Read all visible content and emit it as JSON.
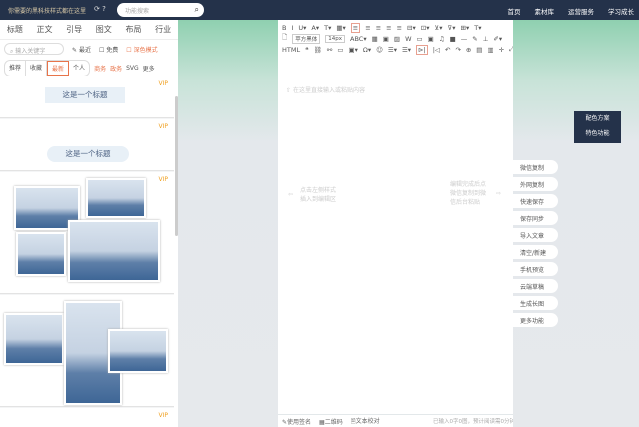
{
  "topbar": {
    "notice": "你需要的黑科技样式都在这里",
    "search_placeholder": "功能搜索",
    "nav": [
      "首页",
      "素材库",
      "运营服务",
      "学习成长"
    ]
  },
  "left": {
    "tabs": [
      "标题",
      "正文",
      "引导",
      "图文",
      "布局",
      "行业"
    ],
    "keyword_placeholder": "输入关键字",
    "recent": "最近",
    "free": "免费",
    "dark_mode": "深色模式",
    "segments": [
      "推荐",
      "收藏",
      "最新",
      "个人"
    ],
    "filters": [
      "商务",
      "政务",
      "SVG",
      "更多"
    ],
    "cards": [
      {
        "vip": "VIP",
        "title": "这是一个标题"
      },
      {
        "vip": "VIP",
        "title": "这是一个标题"
      },
      {
        "vip": "VIP"
      },
      {
        "vip": "VIP"
      }
    ]
  },
  "editor": {
    "toolbar": {
      "font": "苹方黑体",
      "size": "14px",
      "row1": [
        "B",
        "I",
        "U▾",
        "A▾",
        "T▾",
        "▦▾",
        "≡",
        "≡",
        "≡",
        "≡",
        "≡",
        "⊟▾",
        "⊡▾",
        "⊻▾",
        "⊽▾",
        "⊞▾",
        "T▾"
      ],
      "row2": [
        "ABC▾",
        "▦",
        "▣",
        "▨",
        "W",
        "▭",
        "▣",
        "♫",
        "■",
        "—",
        "✎",
        "⊥",
        "✐▾"
      ],
      "row3": [
        "HTML",
        "❝",
        "⛓",
        "⚯",
        "▭",
        "▣▾",
        "Ω▾",
        "☺",
        "☰▾",
        "☰▾",
        "⊳|",
        "|◁",
        "↶",
        "↷",
        "⊕",
        "▤",
        "▥",
        "✛",
        "⤢"
      ]
    },
    "placeholder": "在这里直接输入或粘贴内容",
    "hint_left": [
      "点击左侧样式",
      "插入到编辑区"
    ],
    "hint_right": [
      "编辑完成后点",
      "微信复制到微",
      "信后台粘贴"
    ],
    "footer": {
      "signature": "使用签名",
      "qrcode": "二维码",
      "proofread": "文本校对",
      "stats": "已输入0字0图，预计阅读需0分钟"
    }
  },
  "theme": {
    "color_scheme": "配色方案",
    "features": "特色功能"
  },
  "side_buttons": [
    "微信复制",
    "外网复制",
    "快速保存",
    "保存同步",
    "导入文章",
    "清空/新建",
    "手机预览",
    "云端草稿",
    "生成长图",
    "更多功能"
  ]
}
